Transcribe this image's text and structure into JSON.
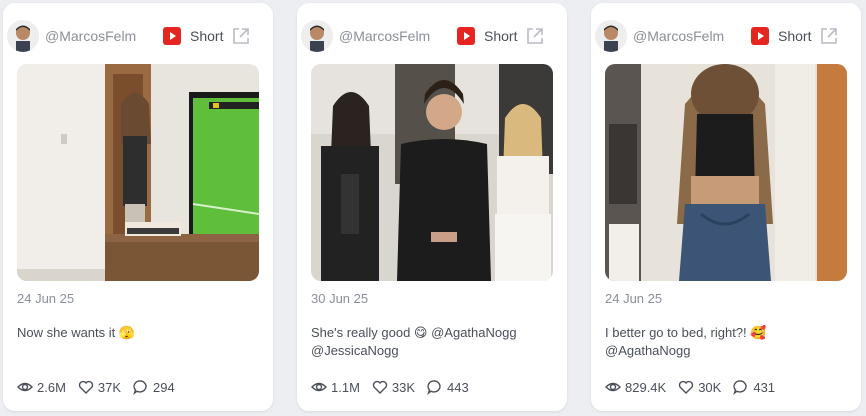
{
  "colors": {
    "youtube_red": "#e52521",
    "card_bg": "#ffffff",
    "page_bg": "#eceef2"
  },
  "cards": [
    {
      "handle": "@MarcosFelm",
      "platform_label": "Short",
      "date": "24 Jun 25",
      "caption_lines": [
        "Now she wants it 🫣"
      ],
      "views": "2.6M",
      "likes": "37K",
      "comments": "294"
    },
    {
      "handle": "@MarcosFelm",
      "platform_label": "Short",
      "date": "30 Jun 25",
      "caption_lines": [
        "She's really good 😋 @AgathaNogg",
        "@JessicaNogg"
      ],
      "views": "1.1M",
      "likes": "33K",
      "comments": "443"
    },
    {
      "handle": "@MarcosFelm",
      "platform_label": "Short",
      "date": "24 Jun 25",
      "caption_lines": [
        "I better go to bed, right?! 🥰",
        "@AgathaNogg"
      ],
      "views": "829.4K",
      "likes": "30K",
      "comments": "431"
    }
  ]
}
